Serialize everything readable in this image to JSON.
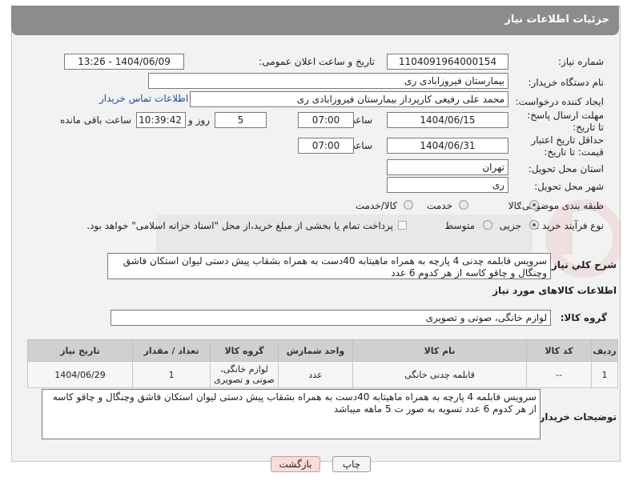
{
  "header": {
    "title": "جزئیات اطلاعات نیاز"
  },
  "fields": {
    "need_number_label": "شماره نیاز:",
    "need_number": "1104091964000154",
    "announce_label": "تاریخ و ساعت اعلان عمومی:",
    "announce_value": "1404/06/09 - 13:26",
    "buyer_org_label": "نام دستگاه خریدار:",
    "buyer_org": "بیمارستان فیروزابادی ری",
    "creator_label": "ایجاد کننده درخواست:",
    "creator": "محمد علی رفیعی کارپرداز بیمارستان فیروزابادی ری",
    "contact_link": "اطلاعات تماس خریدار",
    "reply_deadline_label": "مهلت ارسال پاسخ: تا تاریخ:",
    "reply_date": "1404/06/15",
    "time_label": "ساعت",
    "reply_time": "07:00",
    "days_value": "5",
    "days_label": "روز و",
    "remaining_time": "10:39:42",
    "remaining_label": "ساعت باقی مانده",
    "price_validity_label": "حداقل تاریخ اعتبار قیمت: تا تاریخ:",
    "price_date": "1404/06/31",
    "price_time": "07:00",
    "province_label": "استان محل تحویل:",
    "province": "تهران",
    "city_label": "شهر محل تحویل:",
    "city": "ری",
    "category_label": "طبقه بندی موضوعی:",
    "category_options": [
      "کالا",
      "خدمت",
      "کالا/خدمت"
    ],
    "process_label": "نوع فرآیند خرید :",
    "process_options": [
      "جزیی",
      "متوسط"
    ],
    "payment_note": "پرداخت تمام یا بخشی از مبلغ خرید،از محل \"اسناد خزانه اسلامی\" خواهد بود.",
    "summary_label": "شرح کلي نياز:",
    "summary": "سرویس قابلمه چدنی 4 پارچه به همراه ماهیتابه 40دست به همراه بشقاب پیش دستی لیوان استکان قاشق وچنگال و چاقو کاسه از هر کدوم 6 عدد",
    "goods_info_title": "اطلاعات کالاهای مورد نیاز",
    "goods_group_label": "گروه کالا:",
    "goods_group": "لوازم خانگی، صوتی و تصویری"
  },
  "table": {
    "headers": [
      "ردیف",
      "کد کالا",
      "نام کالا",
      "واحد شمارش",
      "گروه کالا",
      "تعداد / مقدار",
      "تاریخ نیاز"
    ],
    "rows": [
      [
        "1",
        "--",
        "قابلمه چدنی خانگی",
        "عدد",
        "لوازم خانگی، صوتی و تصویری",
        "1",
        "1404/06/29"
      ]
    ]
  },
  "buyer_notes_label": "توضیحات خریدار:",
  "buyer_notes": "سرویس قابلمه 4 پارچه به همراه ماهیتابه 40دست به همراه بشقاب پیش دستی لیوان استکان قاشق وچنگال و چاقو کاسه از هر کدوم 6 عدد  تسویه به صور ت 5 ماهه میباشد",
  "buttons": {
    "print": "چاپ",
    "back": "بازگشت"
  },
  "colors": {
    "header_bg": "#8c8c8c",
    "link": "#1a4ea8",
    "back_btn": "#f9dcdc",
    "watermark": "#c0392b"
  }
}
